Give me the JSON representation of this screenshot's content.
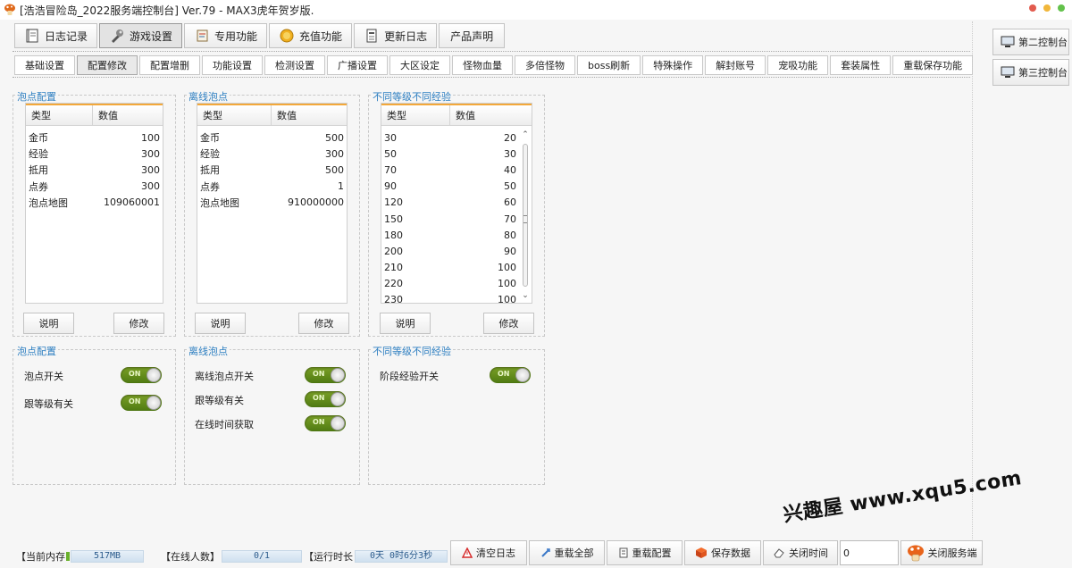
{
  "window": {
    "title": "[浩浩冒险岛_2022服务端控制台] Ver.79 - MAX3虎年贺岁版."
  },
  "main_tabs": [
    {
      "label": "日志记录",
      "icon": "notebook-icon"
    },
    {
      "label": "游戏设置",
      "icon": "wrench-icon"
    },
    {
      "label": "专用功能",
      "icon": "scroll-icon"
    },
    {
      "label": "充值功能",
      "icon": "coin-icon"
    },
    {
      "label": "更新日志",
      "icon": "document-icon"
    },
    {
      "label": "产品声明",
      "icon": ""
    }
  ],
  "active_main_tab": "游戏设置",
  "sub_tabs": [
    "基础设置",
    "配置修改",
    "配置增删",
    "功能设置",
    "检测设置",
    "广播设置",
    "大区设定",
    "怪物血量",
    "多倍怪物",
    "boss刷新",
    "特殊操作",
    "解封账号",
    "宠吸功能",
    "套装属性",
    "重载保存功能"
  ],
  "active_sub_tab": "配置修改",
  "side_buttons": [
    {
      "label": "第二控制台"
    },
    {
      "label": "第三控制台"
    }
  ],
  "panels": [
    {
      "title": "泡点配置",
      "columns": [
        "类型",
        "数值"
      ],
      "rows": [
        [
          "金币",
          "100"
        ],
        [
          "经验",
          "300"
        ],
        [
          "抵用",
          "300"
        ],
        [
          "点券",
          "300"
        ],
        [
          "泡点地图",
          "109060001"
        ]
      ],
      "buttons": [
        "说明",
        "修改"
      ]
    },
    {
      "title": "离线泡点",
      "columns": [
        "类型",
        "数值"
      ],
      "rows": [
        [
          "金币",
          "500"
        ],
        [
          "经验",
          "300"
        ],
        [
          "抵用",
          "500"
        ],
        [
          "点券",
          "1"
        ],
        [
          "泡点地图",
          "910000000"
        ]
      ],
      "buttons": [
        "说明",
        "修改"
      ]
    },
    {
      "title": "不同等级不同经验",
      "columns": [
        "类型",
        "数值"
      ],
      "rows": [
        [
          "30",
          "20"
        ],
        [
          "50",
          "30"
        ],
        [
          "70",
          "40"
        ],
        [
          "90",
          "50"
        ],
        [
          "120",
          "60"
        ],
        [
          "150",
          "70"
        ],
        [
          "180",
          "80"
        ],
        [
          "200",
          "90"
        ],
        [
          "210",
          "100"
        ],
        [
          "220",
          "100"
        ],
        [
          "230",
          "100"
        ]
      ],
      "buttons": [
        "说明",
        "修改"
      ]
    }
  ],
  "toggle_panels": [
    {
      "title": "泡点配置",
      "toggles": [
        {
          "label": "泡点开关",
          "state": "ON"
        },
        {
          "label": "跟等级有关",
          "state": "ON"
        }
      ]
    },
    {
      "title": "离线泡点",
      "toggles": [
        {
          "label": "离线泡点开关",
          "state": "ON"
        },
        {
          "label": "跟等级有关",
          "state": "ON"
        },
        {
          "label": "在线时间获取",
          "state": "ON"
        }
      ]
    },
    {
      "title": "不同等级不同经验",
      "toggles": [
        {
          "label": "阶段经验开关",
          "state": "ON"
        }
      ]
    }
  ],
  "status": {
    "memory_label": "【当前内存",
    "memory_value": "517MB",
    "online_label": "【在线人数】",
    "online_value": "0/1",
    "runtime_label": "【运行时长",
    "runtime_value": "0天 0时6分3秒"
  },
  "bottom_buttons": [
    {
      "label": "清空日志",
      "icon": "warning-icon"
    },
    {
      "label": "重载全部",
      "icon": "reload-icon"
    },
    {
      "label": "重载配置",
      "icon": "config-icon"
    },
    {
      "label": "保存数据",
      "icon": "save-icon"
    },
    {
      "label": "关闭时间",
      "icon": "eraser-icon"
    }
  ],
  "close_time_value": "0",
  "close_server_label": "关闭服务端",
  "watermark": "兴趣屋 www.xqu5.com",
  "colors": {
    "group_title": "#2e7fc1",
    "toggle_on": "#6b9420",
    "header_accent": "#f3a83a"
  }
}
